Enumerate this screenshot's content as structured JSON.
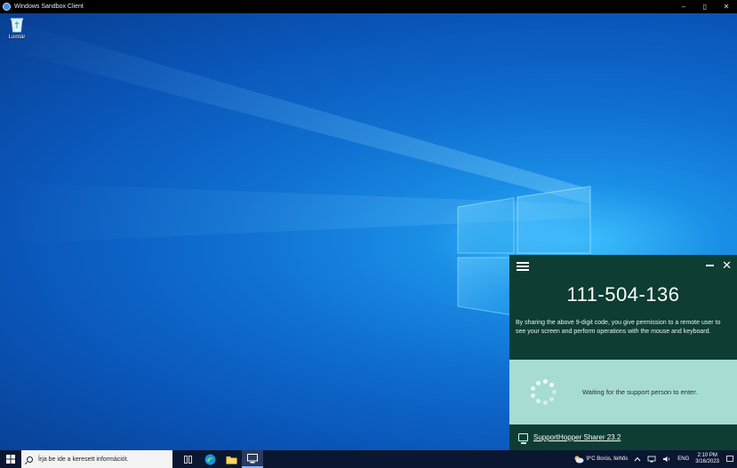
{
  "window": {
    "title": "Windows Sandbox Client",
    "minimize_label": "–",
    "maximize_label": "▯",
    "close_label": "✕"
  },
  "desktop": {
    "recycle_bin_label": "Lomtár"
  },
  "support_panel": {
    "code": "111-504-136",
    "description": "By sharing the above 9-digit code, you give permission to a remote user to see your screen and perform operations with the mouse and keyboard.",
    "waiting_text": "Waiting for the support person to enter.",
    "footer_link": "SupportHopper Sharer 23.2",
    "close_label": "✕"
  },
  "taskbar": {
    "search_placeholder": "Írja be ide a keresett információt.",
    "weather": "9°C  Borús, felhős",
    "tray_text": "ENG",
    "time": "2:10 PM",
    "date": "3/16/2023"
  },
  "colors": {
    "panel_bg": "#0e3d33",
    "wait_bg": "#a7dcd3",
    "taskbar_bg": "#0b1630"
  }
}
